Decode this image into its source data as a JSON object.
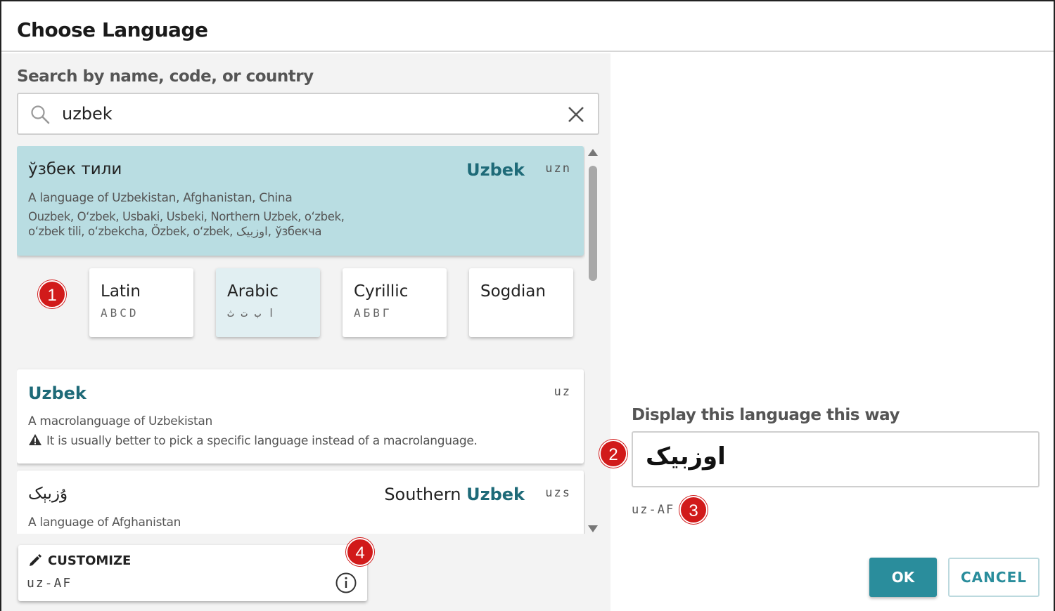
{
  "dialog": {
    "title": "Choose Language"
  },
  "search": {
    "label": "Search by name, code, or country",
    "value": "uzbek"
  },
  "results": [
    {
      "autonym": "ўзбек тили",
      "english_prefix": "",
      "english_highlight": "Uzbek",
      "code": "uzn",
      "description": "A language of Uzbekistan, Afghanistan, China",
      "alternates_line1": "Ouzbek, O‘zbek, Usbaki, Usbeki, Northern Uzbek, oʻzbek,",
      "alternates_line2": "oʻzbek tili, oʻzbekcha, Özbek, o‘zbek, اوزبیک, ўзбекча",
      "selected": true
    },
    {
      "english": "Uzbek",
      "code": "uz",
      "description": "A macrolanguage of Uzbekistan",
      "warning": "It is usually better to pick a specific language instead of a macrolanguage."
    },
    {
      "autonym": "ۇزبېک",
      "english_prefix": "Southern ",
      "english_highlight": "Uzbek",
      "code": "uzs",
      "description": "A language of Afghanistan"
    }
  ],
  "scripts": [
    {
      "name": "Latin",
      "sample": "ABCD",
      "active": false
    },
    {
      "name": "Arabic",
      "sample": "ا ب ت ث",
      "active": true
    },
    {
      "name": "Cyrillic",
      "sample": "АБВГ",
      "active": false
    },
    {
      "name": "Sogdian",
      "sample": "",
      "active": false
    }
  ],
  "customize": {
    "label": "CUSTOMIZE",
    "code": "uz-AF",
    "icon": "pencil-icon"
  },
  "display": {
    "label": "Display this language this way",
    "value": "اوزبیک",
    "code": "uz-AF"
  },
  "buttons": {
    "ok": "OK",
    "cancel": "CANCEL"
  },
  "markers": [
    "1",
    "2",
    "3",
    "4"
  ],
  "colors": {
    "accent": "#2a8d9c",
    "highlight_text": "#1e6a78",
    "selected_bg": "#b9dde2",
    "marker": "#d11a1a"
  }
}
